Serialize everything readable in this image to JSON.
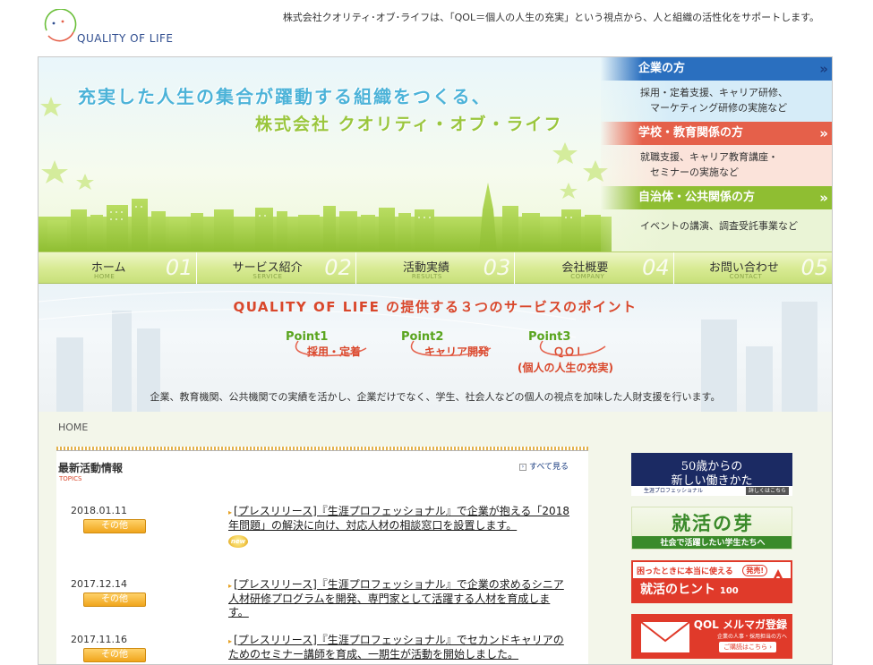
{
  "header": {
    "logo_text": "QUALITY OF LIFE",
    "tagline": "株式会社クオリティ･オブ･ライフは、「QOL＝個人の人生の充実」という視点から、人と組織の活性化をサポートします。"
  },
  "hero": {
    "line1": "充実した人生の集合が躍動する組織をつくる、",
    "line2": "株式会社 クオリティ・オブ・ライフ"
  },
  "side_panel": [
    {
      "title": "企業の方",
      "arrow": "»",
      "body1": "採用・定着支援、キャリア研修、",
      "body2": "　マーケティング研修の実施など"
    },
    {
      "title": "学校・教育関係の方",
      "arrow": "»",
      "body1": "就職支援、キャリア教育講座・",
      "body2": "　セミナーの実施など"
    },
    {
      "title": "自治体・公共関係の方",
      "arrow": "»",
      "body1": "イベントの講演、調査受託事業など",
      "body2": ""
    }
  ],
  "nav": [
    {
      "label": "ホーム",
      "sub": "HOME",
      "num": "01"
    },
    {
      "label": "サービス紹介",
      "sub": "SERVICE",
      "num": "02"
    },
    {
      "label": "活動実績",
      "sub": "RESULTS",
      "num": "03"
    },
    {
      "label": "会社概要",
      "sub": "COMPANY",
      "num": "04"
    },
    {
      "label": "お問い合わせ",
      "sub": "CONTACT",
      "num": "05"
    }
  ],
  "banner": {
    "title": "QUALITY OF LIFE の提供する３つのサービスのポイント",
    "points": [
      {
        "label": "Point1",
        "text1": "採用・定着",
        "text2": ""
      },
      {
        "label": "Point2",
        "text1": "キャリア開発",
        "text2": ""
      },
      {
        "label": "Point3",
        "text1": "ＱＯＬ",
        "text2": "(個人の人生の充実)"
      }
    ],
    "description": "企業、教育機関、公共機関での実績を活かし、企業だけでなく、学生、社会人などの個人の視点を加味した人財支援を行います。"
  },
  "breadcrumb": "HOME",
  "topics": {
    "title": "最新活動情報",
    "subtitle": "TOPICS",
    "see_all": "すべて見る",
    "new_label": "new",
    "items": [
      {
        "date": "2018.01.11",
        "badge": "その他",
        "text": "[プレスリリース]『生涯プロフェッショナル』で企業が抱える「2018年問題」の解決に向け、対応人材の相談窓口を設置します。",
        "is_new": true
      },
      {
        "date": "2017.12.14",
        "badge": "その他",
        "text": "[プレスリリース]『生涯プロフェッショナル』で企業の求めるシニア人材研修プログラムを開発、専門家として活躍する人材を育成します。",
        "is_new": false
      },
      {
        "date": "2017.11.16",
        "badge": "その他",
        "text": "[プレスリリース]『生涯プロフェッショナル』でセカンドキャリアのためのセミナー講師を育成、一期生が活動を開始しました。",
        "is_new": false
      }
    ]
  },
  "ads": {
    "ad1": {
      "line1": "50歳からの",
      "line2": "新しい働きかた",
      "strip": "生涯プロフェッショナル",
      "button": "詳しくはこちら"
    },
    "ad2": {
      "line1": "就活の芽",
      "strip": "社会で活躍したい学生たちへ"
    },
    "ad3": {
      "line1": "困ったときに本当に使える",
      "pill": "発売!",
      "line2": "就活のヒント",
      "num": "100"
    },
    "ad4": {
      "line1": "QOL メルマガ登録",
      "line2": "企業の人事・採用担当の方へ",
      "button": "ご購読はこちら ›"
    }
  },
  "colors": {
    "accent_red": "#d9472b",
    "accent_green": "#9ac63d",
    "accent_blue": "#2a6fbf",
    "nav_green": "#d9eb95"
  }
}
